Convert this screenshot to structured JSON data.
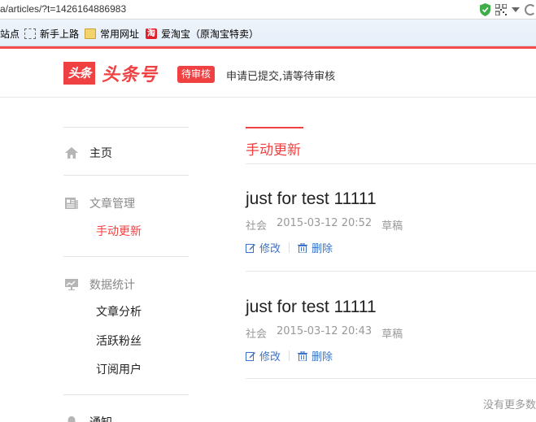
{
  "browser": {
    "url": "a/articles/?t=1426164886983",
    "bookmarks": [
      {
        "label": "站点",
        "icon": "none"
      },
      {
        "label": "新手上路",
        "icon": "dotted-page-icon"
      },
      {
        "label": "常用网址",
        "icon": "folder-icon"
      },
      {
        "label": "爱淘宝（原淘宝特卖）",
        "icon": "taobao-icon",
        "icon_text": "淘"
      }
    ]
  },
  "header": {
    "logo_box": "头条",
    "logo_text": "头条号",
    "status_badge": "待审核",
    "status_message": "申请已提交,请等待审核"
  },
  "sidebar": {
    "home": "主页",
    "article_section": "文章管理",
    "manual_update": "手动更新",
    "stats_section": "数据统计",
    "article_analysis": "文章分析",
    "active_fans": "活跃粉丝",
    "subscribers": "订阅用户",
    "notice_section": "通知"
  },
  "content": {
    "tab_title": "手动更新",
    "articles": [
      {
        "title": "just for test 11111",
        "category": "社会",
        "datetime": "2015-03-12 20:52",
        "status": "草稿",
        "edit_label": "修改",
        "delete_label": "删除"
      },
      {
        "title": "just for test 11111",
        "category": "社会",
        "datetime": "2015-03-12 20:43",
        "status": "草稿",
        "edit_label": "修改",
        "delete_label": "删除"
      }
    ],
    "no_more": "没有更多数"
  },
  "colors": {
    "accent": "#f04142",
    "link": "#3b73c8",
    "muted": "#999999"
  }
}
